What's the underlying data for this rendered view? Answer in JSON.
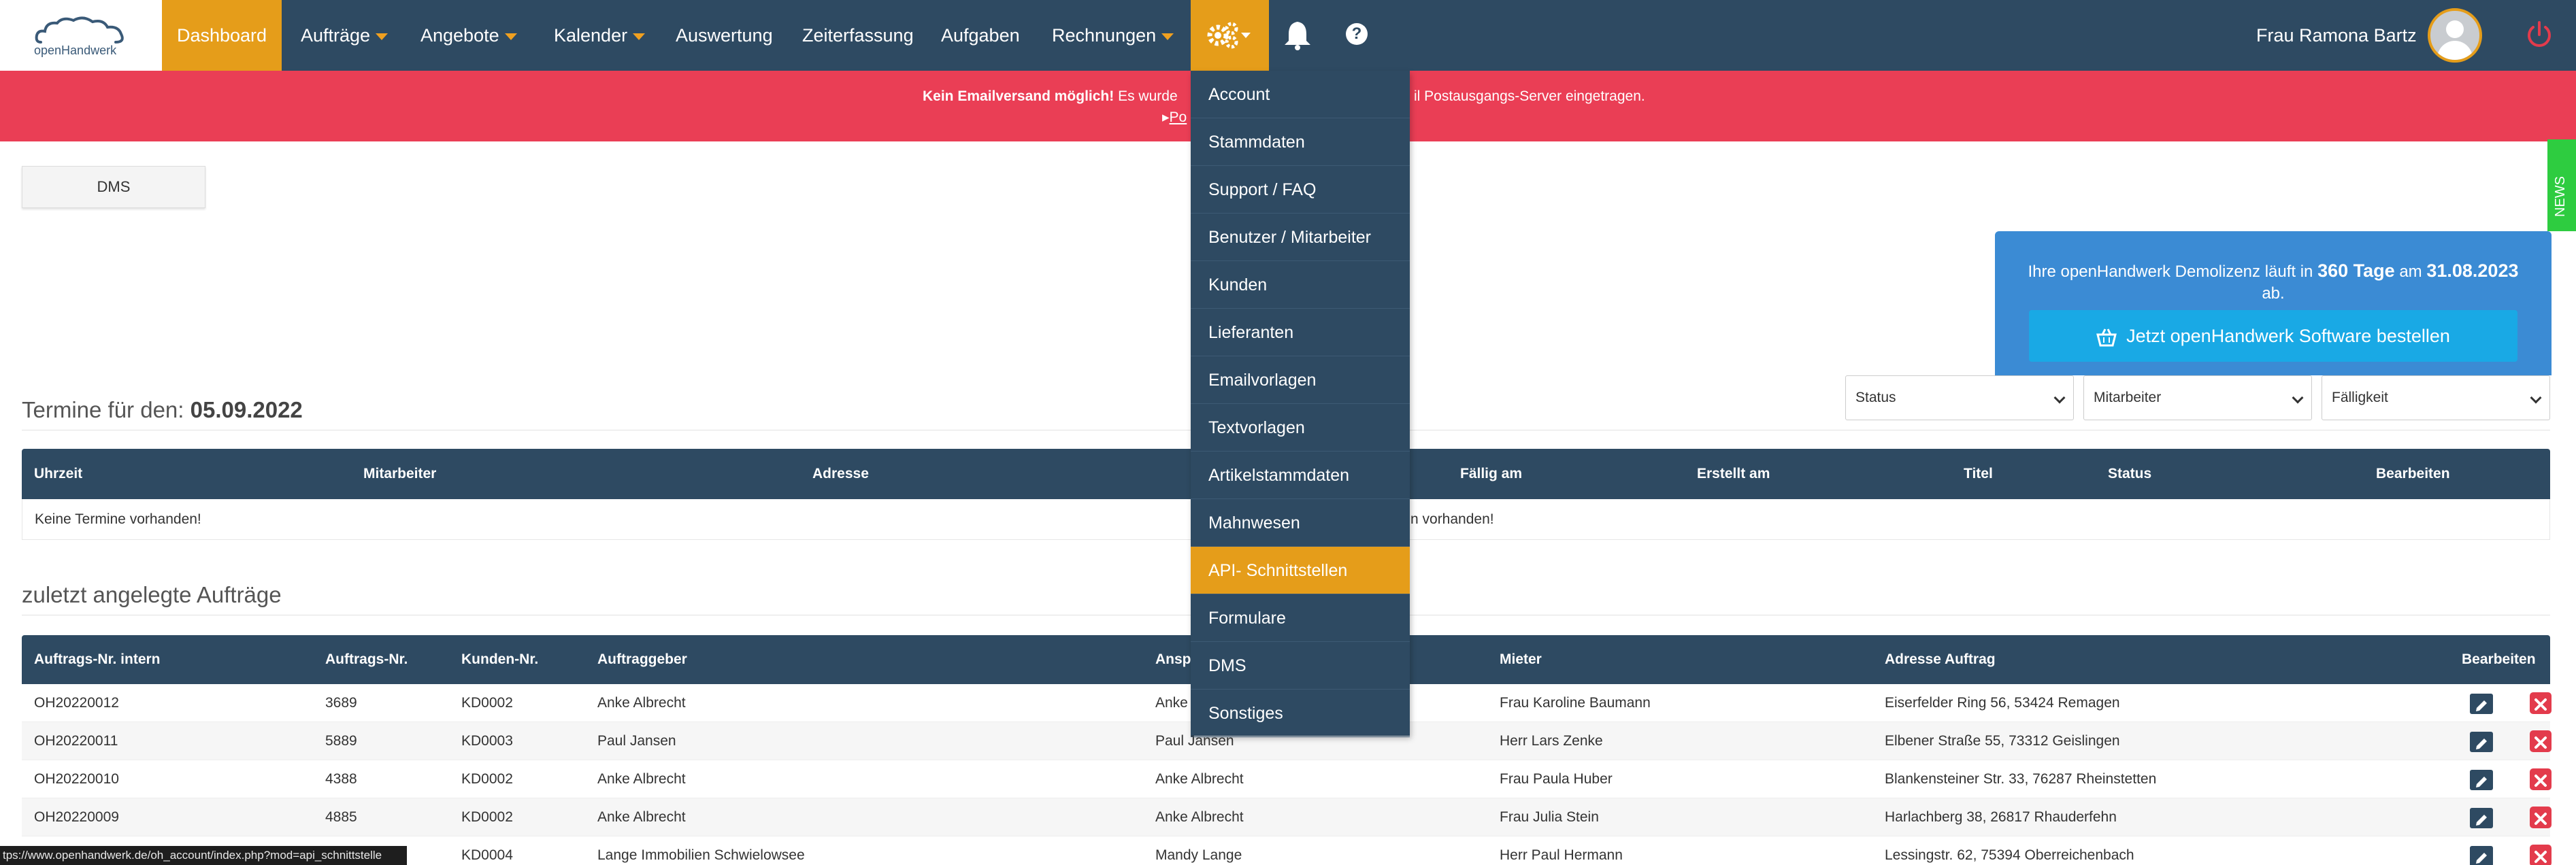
{
  "brand": {
    "logo_text": "openHandwerk"
  },
  "nav": {
    "dashboard": "Dashboard",
    "auftraege": "Aufträge",
    "angebote": "Angebote",
    "kalender": "Kalender",
    "auswertung": "Auswertung",
    "zeiterfassung": "Zeiterfassung",
    "aufgaben": "Aufgaben",
    "rechnungen": "Rechnungen",
    "help": "?",
    "user": "Frau Ramona Bartz"
  },
  "alert": {
    "bold": "Kein Emailversand möglich!",
    "text_left": " Es wurde",
    "text_right": "il Postausgangs-Server eingetragen.",
    "link": "Po"
  },
  "dms_button": "DMS",
  "news_tab": "NEWS",
  "demo": {
    "pre": "Ihre openHandwerk Demolizenz läuft in ",
    "days": "360 Tage",
    "mid": " am ",
    "date": "31.08.2023",
    "post": "ab.",
    "button": "Jetzt openHandwerk Software bestellen"
  },
  "filters": {
    "status": "Status",
    "mitarbeiter": "Mitarbeiter",
    "faelligkeit": "Fälligkeit"
  },
  "termine": {
    "title": "Termine für den: ",
    "date": "05.09.2022",
    "headers": [
      "Uhrzeit",
      "Mitarbeiter",
      "Adresse",
      "Fällig am",
      "Erstellt am",
      "Titel",
      "Status",
      "Bearbeiten"
    ],
    "empty_left": "Keine Termine vorhanden!",
    "empty_right": "n vorhanden!"
  },
  "auftraege": {
    "title": "zuletzt angelegte Aufträge",
    "headers": [
      "Auftrags-Nr. intern",
      "Auftrags-Nr.",
      "Kunden-Nr.",
      "Auftraggeber",
      "Ansp",
      "Mieter",
      "Adresse Auftrag",
      "Bearbeiten"
    ],
    "rows": [
      [
        "OH20220012",
        "3689",
        "KD0002",
        "Anke Albrecht",
        "Anke",
        "Frau Karoline Baumann",
        "Eiserfelder Ring 56, 53424 Remagen"
      ],
      [
        "OH20220011",
        "5889",
        "KD0003",
        "Paul Jansen",
        "Paul Jansen",
        "Herr Lars Zenke",
        "Elbener Straße 55, 73312 Geislingen"
      ],
      [
        "OH20220010",
        "4388",
        "KD0002",
        "Anke Albrecht",
        "Anke Albrecht",
        "Frau Paula Huber",
        "Blankensteiner Str. 33, 76287 Rheinstetten"
      ],
      [
        "OH20220009",
        "4885",
        "KD0002",
        "Anke Albrecht",
        "Anke Albrecht",
        "Frau Julia Stein",
        "Harlachberg 38, 26817 Rhauderfehn"
      ],
      [
        "",
        "",
        "KD0004",
        "Lange Immobilien Schwielowsee",
        "Mandy Lange",
        "Herr Paul Hermann",
        "Lessingstr. 62, 75394 Oberreichenbach"
      ]
    ]
  },
  "dropdown": {
    "items": [
      "Account",
      "Stammdaten",
      "Support / FAQ",
      "Benutzer / Mitarbeiter",
      "Kunden",
      "Lieferanten",
      "Emailvorlagen",
      "Textvorlagen",
      "Artikelstammdaten",
      "Mahnwesen",
      "API- Schnittstellen",
      "Formulare",
      "DMS",
      "Sonstiges"
    ],
    "active": "API- Schnittstellen"
  },
  "statusbar": "tps://www.openhandwerk.de/oh_account/index.php?mod=api_schnittstelle",
  "colors": {
    "navbar": "#2e4a62",
    "accent": "#e59d1a",
    "alert": "#ea3e55",
    "demo": "#3b8bd4",
    "order_button": "#19a9e5",
    "news": "#2ecc40",
    "delete": "#e33b4c"
  }
}
